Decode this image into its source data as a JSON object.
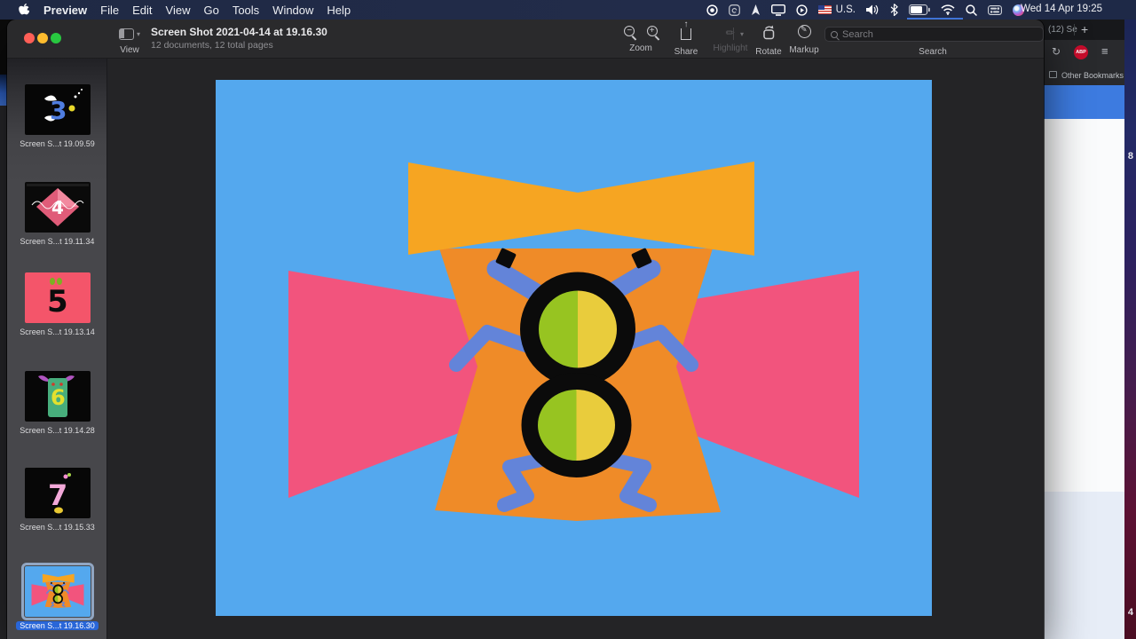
{
  "menu_bar": {
    "app_menus": [
      "Preview",
      "File",
      "Edit",
      "View",
      "Go",
      "Tools",
      "Window",
      "Help"
    ],
    "input_source": "U.S.",
    "clock": "Wed 14 Apr 19:25"
  },
  "window": {
    "title": "Screen Shot 2021-04-14 at 19.16.30",
    "subtitle": "12 documents, 12 total pages",
    "view_label": "View",
    "toolbar": {
      "zoom_label": "Zoom",
      "share_label": "Share",
      "highlight_label": "Highlight",
      "rotate_label": "Rotate",
      "markup_label": "Markup",
      "search_label": "Search",
      "search_placeholder": "Search"
    }
  },
  "sidebar": {
    "items": [
      {
        "label": "Screen S...t 19.09.59",
        "digit": "3"
      },
      {
        "label": "Screen S...t 19.11.34",
        "digit": "4"
      },
      {
        "label": "Screen S...t 19.13.14",
        "digit": "5"
      },
      {
        "label": "Screen S...t 19.14.28",
        "digit": "6"
      },
      {
        "label": "Screen S...t 19.15.33",
        "digit": "7"
      },
      {
        "label": "Screen S...t 19.16.30",
        "digit": "8",
        "selected": true
      }
    ]
  },
  "browser": {
    "tab_title": "(12) Se",
    "new_tab": "+",
    "abp_badge": "ABP",
    "bookmarks_label": "Other Bookmarks"
  },
  "wallpaper": {
    "digit_top": "8",
    "digit_bottom": "4"
  },
  "artwork": {
    "subject": "number 8 bug character",
    "colors": {
      "background": "#54a8ee",
      "pink": "#f2547d",
      "body_orange": "#ef8b28",
      "bowtie_orange": "#f6a522",
      "limb_blue": "#6384d9",
      "green": "#97c421",
      "yellow": "#e9cc3c",
      "outline": "#0b0b0b"
    }
  }
}
